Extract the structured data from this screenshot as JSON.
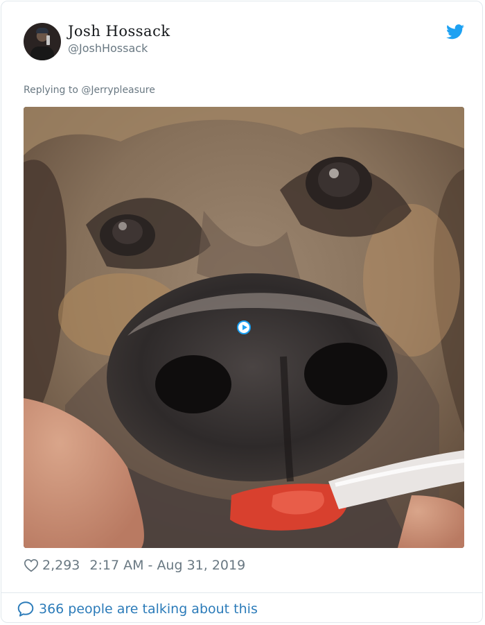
{
  "tweet": {
    "author": {
      "display_name": "Josh Hossack",
      "handle": "@JoshHossack",
      "avatar_icon": "profile-photo"
    },
    "reply_to": "Replying to @Jerrypleasure",
    "media": {
      "kind": "video",
      "subject": "dog close-up",
      "play_icon": "play-icon"
    },
    "likes": "2,293",
    "timestamp": "2:17 AM - Aug 31, 2019",
    "conversation_link": "366 people are talking about this"
  },
  "colors": {
    "twitter_blue": "#1da1f2",
    "link_blue": "#2b7bb9",
    "muted_text": "#697882",
    "name_text": "#14171a",
    "border": "#e1e8ed"
  }
}
